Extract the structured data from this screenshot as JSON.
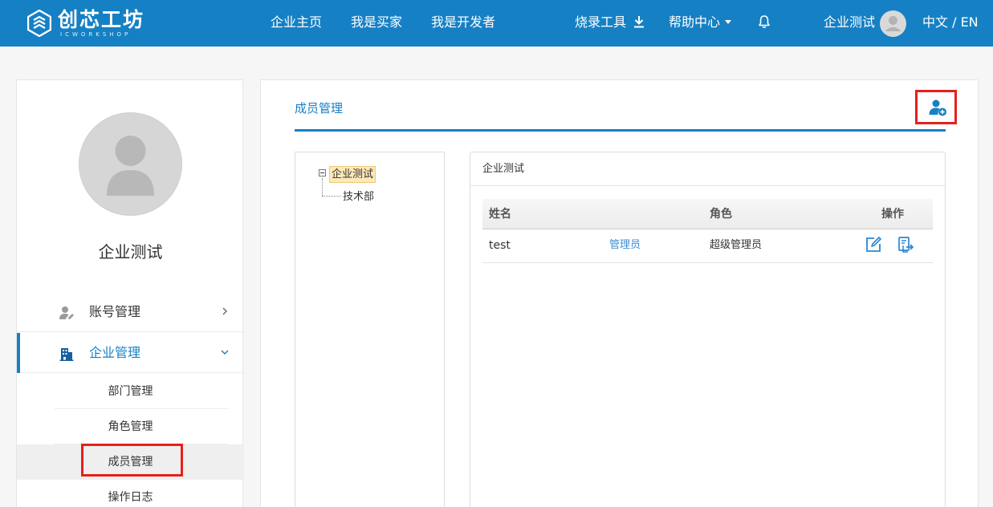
{
  "header": {
    "logo_title": "创芯工坊",
    "logo_subtitle": "ICWORKSHOP",
    "nav": [
      {
        "label": "企业主页"
      },
      {
        "label": "我是买家"
      },
      {
        "label": "我是开发者"
      }
    ],
    "tools_label": "烧录工具",
    "help_label": "帮助中心",
    "user_name": "企业测试",
    "language": "中文 / EN"
  },
  "sidebar": {
    "company_name": "企业测试",
    "menu": [
      {
        "label": "账号管理",
        "icon": "user-edit-icon",
        "expanded": false
      },
      {
        "label": "企业管理",
        "icon": "building-icon",
        "expanded": true
      }
    ],
    "submenu": [
      {
        "label": "部门管理"
      },
      {
        "label": "角色管理"
      },
      {
        "label": "成员管理",
        "active": true
      },
      {
        "label": "操作日志"
      }
    ]
  },
  "main": {
    "page_title": "成员管理",
    "tree": {
      "root": "企业测试",
      "children": [
        "技术部"
      ]
    },
    "panel_title": "企业测试",
    "table": {
      "headers": [
        "姓名",
        "角色",
        "操作"
      ],
      "rows": [
        {
          "name": "test",
          "role_link": "管理员",
          "role": "超级管理员"
        }
      ]
    }
  },
  "colors": {
    "brand": "#1680c4",
    "highlight": "#e5201c",
    "link": "#3a8ed4"
  }
}
